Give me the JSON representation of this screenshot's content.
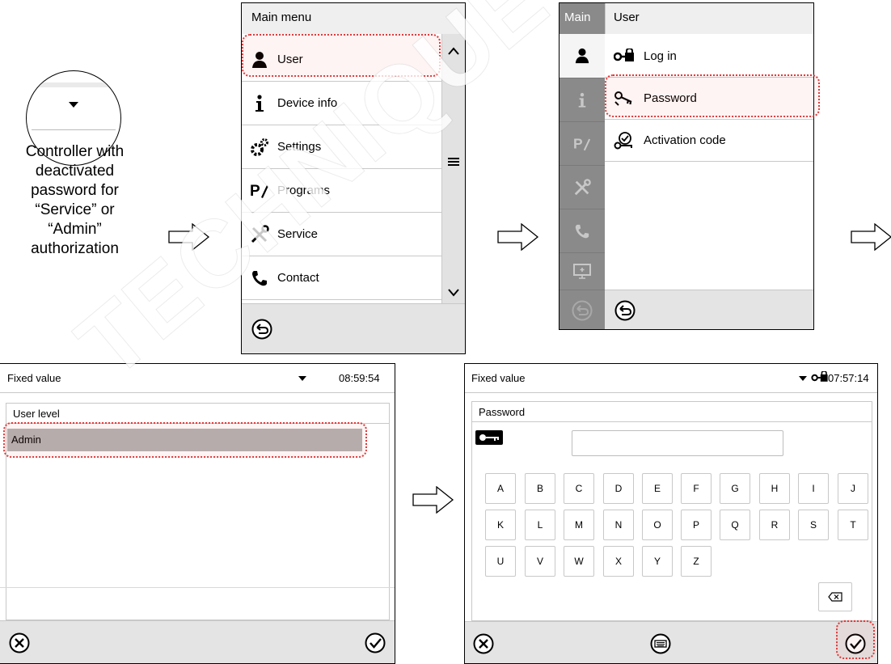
{
  "caption": "Controller with\ndeactivated\npassword for\n“Service” or\n“Admin”\nauthorization",
  "main_menu": {
    "title": "Main menu",
    "items": [
      {
        "label": "User",
        "icon": "user-icon"
      },
      {
        "label": "Device info",
        "icon": "info-icon"
      },
      {
        "label": "Settings",
        "icon": "gears-icon"
      },
      {
        "label": "Programs",
        "icon": "programs-icon"
      },
      {
        "label": "Service",
        "icon": "service-tools-icon"
      },
      {
        "label": "Contact",
        "icon": "phone-icon"
      }
    ]
  },
  "user_menu": {
    "side_title": "Main",
    "title": "User",
    "items": [
      {
        "label": "Log in",
        "icon": "login-lock-icon"
      },
      {
        "label": "Password",
        "icon": "password-key-icon"
      },
      {
        "label": "Activation code",
        "icon": "activation-code-icon"
      }
    ]
  },
  "user_level_screen": {
    "mode": "Fixed value",
    "time": "08:59:54",
    "section_title": "User level",
    "selected_value": "Admin"
  },
  "password_screen": {
    "mode": "Fixed value",
    "time": "07:57:14",
    "section_title": "Password",
    "input_value": "",
    "keys_row1": [
      "A",
      "B",
      "C",
      "D",
      "E",
      "F",
      "G",
      "H",
      "I",
      "J"
    ],
    "keys_row2": [
      "K",
      "L",
      "M",
      "N",
      "O",
      "P",
      "Q",
      "R",
      "S",
      "T"
    ],
    "keys_row3": [
      "U",
      "V",
      "W",
      "X",
      "Y",
      "Z"
    ]
  },
  "watermark": "TECHNIQUE DUTSCHER",
  "colors": {
    "highlight": "#e03a3a",
    "selected_row": "#b3b3b3",
    "sidebar": "#8a8a8a"
  }
}
